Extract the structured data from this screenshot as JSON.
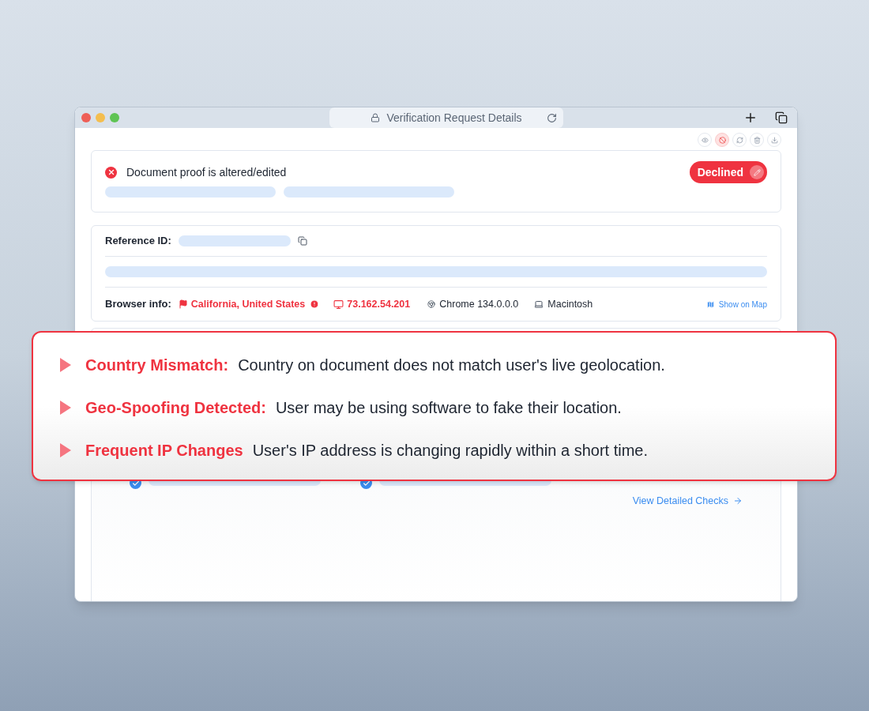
{
  "window": {
    "title": "Verification Request Details"
  },
  "toolbar": [
    {
      "kind": "view",
      "selected": false
    },
    {
      "kind": "block",
      "selected": true
    },
    {
      "kind": "refresh",
      "selected": false
    },
    {
      "kind": "delete",
      "selected": false
    },
    {
      "kind": "download",
      "selected": false
    }
  ],
  "alert": {
    "message": "Document proof is altered/edited",
    "status": "Declined"
  },
  "reference": {
    "label": "Reference ID:"
  },
  "browser_info": {
    "label": "Browser info:",
    "location": "California, United States",
    "ip": "73.162.54.201",
    "browser": "Chrome 134.0.0.0",
    "os": "Macintosh",
    "map_link": "Show on Map"
  },
  "checks": {
    "items": [
      {
        "checked": true
      },
      {
        "checked": true
      }
    ],
    "link": "View Detailed Checks"
  },
  "callout": {
    "items": [
      {
        "title": "Country Mismatch:",
        "description": "Country on document does not match user's live geolocation."
      },
      {
        "title": "Geo-Spoofing Detected:",
        "description": "User may be using software to fake their location."
      },
      {
        "title": "Frequent IP Changes",
        "description": "User's IP address is changing rapidly within a short time."
      }
    ]
  }
}
